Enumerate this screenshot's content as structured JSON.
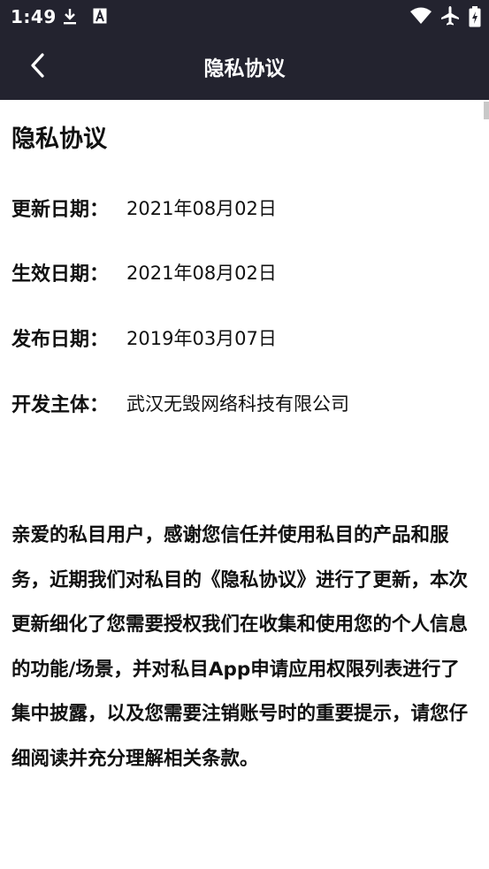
{
  "status_bar": {
    "time": "1:49",
    "left_icons": [
      "download-icon",
      "a-notification-icon"
    ],
    "right_icons": [
      "wifi-icon",
      "airplane-icon",
      "battery-icon"
    ]
  },
  "nav": {
    "back_icon": "chevron-left-icon",
    "title": "隐私协议"
  },
  "document": {
    "title": "隐私协议",
    "meta": [
      {
        "label": "更新日期：",
        "value": "2021年08月02日"
      },
      {
        "label": "生效日期：",
        "value": "2021年08月02日"
      },
      {
        "label": "发布日期：",
        "value": "2019年03月07日"
      },
      {
        "label": "开发主体：",
        "value": "武汉无毁网络科技有限公司"
      }
    ],
    "body": "亲爱的私目用户，感谢您信任并使用私目的产品和服务，近期我们对私目的《隐私协议》进行了更新，本次更新细化了您需要授权我们在收集和使用您的个人信息的功能/场景，并对私目App申请应用权限列表进行了集中披露，以及您需要注销账号时的重要提示，请您仔细阅读并充分理解相关条款。"
  },
  "colors": {
    "header_bg": "#23232f",
    "header_text": "#ffffff",
    "page_bg": "#ffffff",
    "text": "#111111"
  }
}
